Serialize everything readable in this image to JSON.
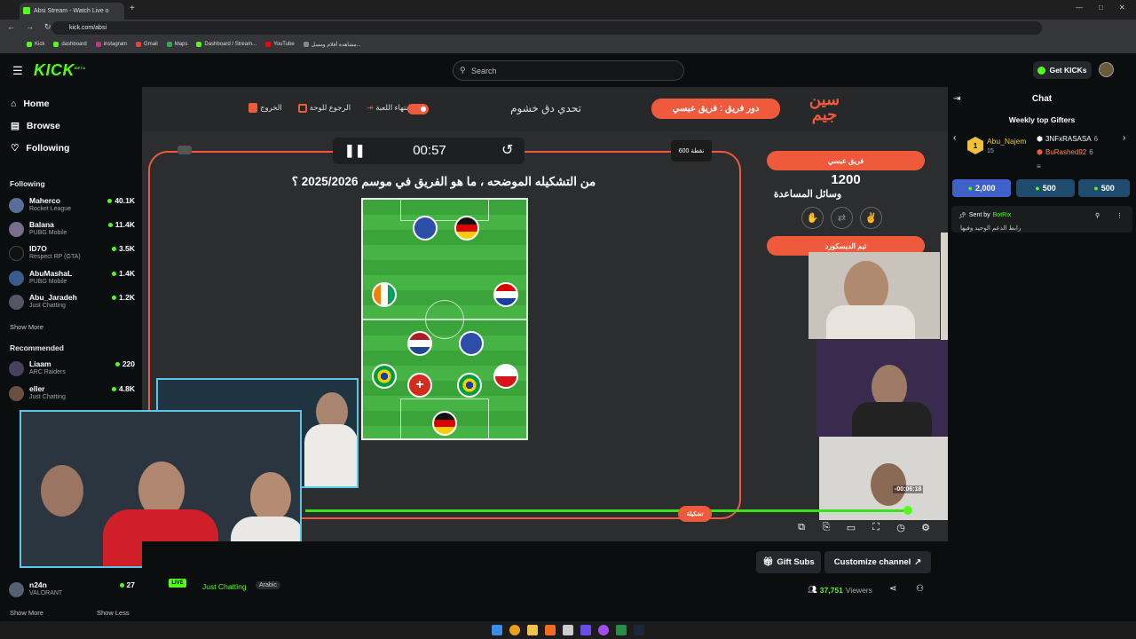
{
  "browser": {
    "tab_title": "Absi Stream - Watch Live o",
    "url": "kick.com/absi",
    "bookmarks": [
      "Kick",
      "dashboard",
      "instagram",
      "Gmail",
      "Maps",
      "Dashboard / Stream...",
      "YouTube",
      "مشاهدة أفلام ومسل..."
    ]
  },
  "header": {
    "logo": "KICK",
    "logo_badge": "BETA",
    "search_placeholder": "Search",
    "get_kicks": "Get KICKs"
  },
  "sidebar": {
    "nav": [
      {
        "label": "Home",
        "icon": "home-icon"
      },
      {
        "label": "Browse",
        "icon": "browse-icon"
      },
      {
        "label": "Following",
        "icon": "heart-icon"
      }
    ],
    "following_title": "Following",
    "following": [
      {
        "name": "Maherco",
        "game": "Rocket League",
        "viewers": "40.1K"
      },
      {
        "name": "Balana",
        "game": "PUBG Mobile",
        "viewers": "11.4K"
      },
      {
        "name": "ID7O",
        "game": "Respect RP (GTA)",
        "viewers": "3.5K"
      },
      {
        "name": "AbuMashaL",
        "game": "PUBG Mobile",
        "viewers": "1.4K"
      },
      {
        "name": "Abu_Jaradeh",
        "game": "Just Chatting",
        "viewers": "1.2K"
      }
    ],
    "show_more": "Show More",
    "recommended_title": "Recommended",
    "recommended": [
      {
        "name": "Liaam",
        "game": "ARC Raiders",
        "viewers": "220"
      },
      {
        "name": "eller",
        "game": "Just Chatting",
        "viewers": "4.8K"
      }
    ],
    "bottom_channel": {
      "name": "n24n",
      "game": "VALORANT",
      "viewers": "27"
    },
    "show_more_bottom": "Show More",
    "show_less": "Show Less"
  },
  "game": {
    "exit_label": "الخروج",
    "back_label": "الرجوع للوحة",
    "end_game_label": "انتهاء اللعبة",
    "challenge_title": "تحدي دق خشوم",
    "team_turn_label": "دور فريق : فريق عبسي",
    "timer": "00:57",
    "points": "600 نقطة",
    "question": "من التشكيله الموضحه ، ما هو الفريق في موسم 2025/2026 ؟",
    "team1_name": "فريق عبسي",
    "team1_score": "1200",
    "helpers_label": "وسائل المساعدة",
    "team2_name": "تيم الديسكورد",
    "reveal_label": "تشكيلة"
  },
  "player": {
    "time_tooltip": "-00:06:18",
    "progress_fraction": 0.99
  },
  "stream_info": {
    "live_badge": "LIVE",
    "category": "Just Chatting",
    "language": "Arabic",
    "gift_subs": "Gift Subs",
    "customize_channel": "Customize channel",
    "viewers": "37,751",
    "viewers_label": "Viewers"
  },
  "chat": {
    "title": "Chat",
    "gifters_title": "Weekly top Gifters",
    "top_gifter": {
      "rank": "1",
      "name": "Abu_Najem",
      "count": "15"
    },
    "gifter2": {
      "name": "3NFxRASASA",
      "count": "6"
    },
    "gifter3": {
      "name": "BuRashed92",
      "count": "6"
    },
    "gift_buttons": [
      "2,000",
      "500",
      "500"
    ],
    "pinned_sent_by": "Sent by",
    "pinned_bot": "BotRix",
    "pinned_text": "رابط الدعم الوحيد وفيها"
  },
  "colors": {
    "kick_green": "#53fc18",
    "game_orange": "#f05a3c"
  }
}
